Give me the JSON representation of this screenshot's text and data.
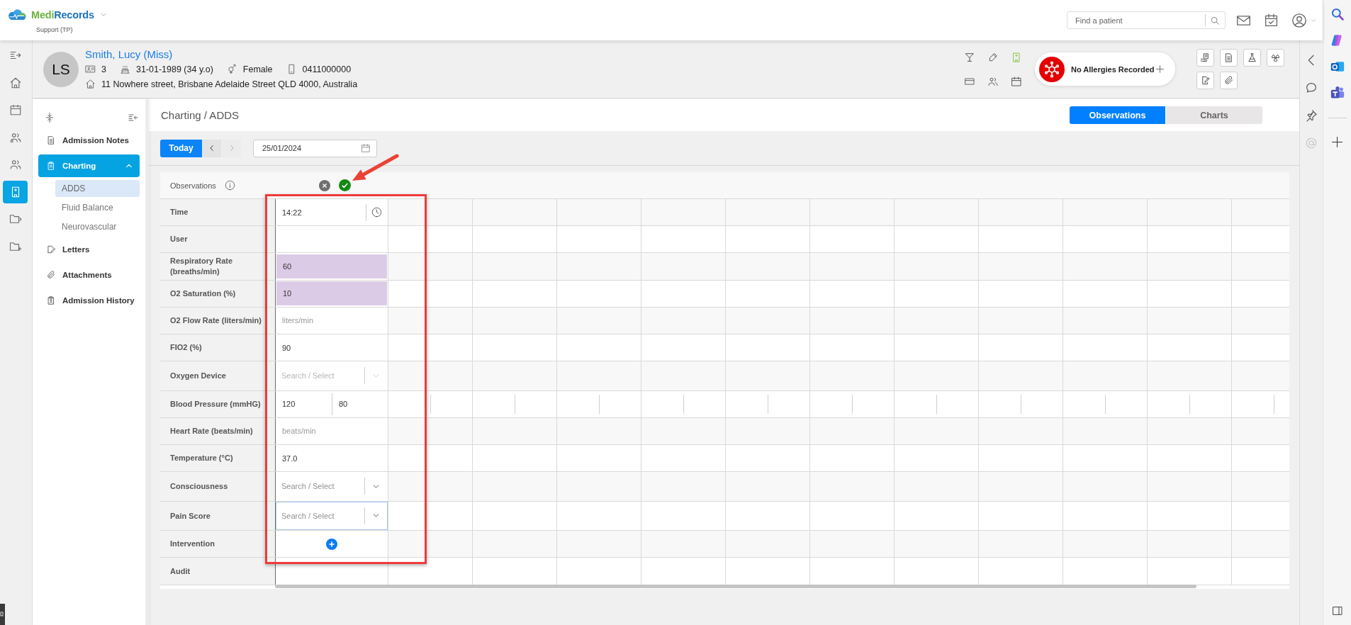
{
  "header": {
    "brand": [
      "Medi",
      "Records"
    ],
    "organisation": "Support (TP)",
    "search": {
      "placeholder": "Find a patient"
    }
  },
  "rail": {
    "items": [
      {
        "selected": false
      },
      {
        "selected": false
      },
      {
        "selected": false
      },
      {
        "selected": false
      },
      {
        "selected": false
      },
      {
        "selected": true
      },
      {
        "selected": false
      },
      {
        "selected": false
      }
    ]
  },
  "patient": {
    "initials": "LS",
    "name": "Smith, Lucy (Miss)",
    "id": "3",
    "dob": "31-01-1989 (34 y.o)",
    "gender": "Female",
    "phone": "0411000000",
    "address": "11 Nowhere street, Brisbane Adelaide Street QLD 4000, Australia"
  },
  "allergies": {
    "label": "No Allergies Recorded"
  },
  "nav": {
    "items": [
      {
        "label": "Admission Notes",
        "selected": false
      },
      {
        "label": "Charting",
        "selected": true,
        "expanded": true,
        "children": [
          {
            "label": "ADDS",
            "selected": true
          },
          {
            "label": "Fluid Balance",
            "selected": false
          },
          {
            "label": "Neurovascular",
            "selected": false
          }
        ]
      },
      {
        "label": "Letters",
        "selected": false
      },
      {
        "label": "Attachments",
        "selected": false
      },
      {
        "label": "Admission History",
        "selected": false
      }
    ]
  },
  "breadcrumb": "Charting / ADDS",
  "view_tabs": [
    {
      "label": "Observations",
      "selected": true
    },
    {
      "label": "Charts",
      "selected": false
    }
  ],
  "toolbar": {
    "today": "Today",
    "prev": {
      "disabled": false
    },
    "next": {
      "disabled": true
    },
    "date": "25/01/2024"
  },
  "observations": {
    "title": "Observations",
    "rows": [
      {
        "label": "Time",
        "kind": "time",
        "value": "14:22"
      },
      {
        "label": "User",
        "kind": "blank"
      },
      {
        "label": "Respiratory Rate (breaths/min)",
        "kind": "input",
        "value": "60",
        "flagged": true
      },
      {
        "label": "O2 Saturation (%)",
        "kind": "input",
        "value": "10",
        "flagged": true
      },
      {
        "label": "O2 Flow Rate (liters/min)",
        "kind": "input",
        "placeholder": "liters/min",
        "flagged": false
      },
      {
        "label": "FIO2 (%)",
        "kind": "input",
        "value": "90",
        "flagged": false
      },
      {
        "label": "Oxygen Device",
        "kind": "select",
        "placeholder": "Search / Select",
        "disabled": true,
        "focused": false
      },
      {
        "label": "Blood Pressure (mmHG)",
        "kind": "pair",
        "values": [
          "120",
          "80"
        ]
      },
      {
        "label": "Heart Rate (beats/min)",
        "kind": "input",
        "placeholder": "beats/min",
        "flagged": false
      },
      {
        "label": "Temperature (°C)",
        "kind": "input",
        "value": "37.0",
        "flagged": false
      },
      {
        "label": "Consciousness",
        "kind": "select",
        "placeholder": "Search / Select",
        "disabled": false,
        "focused": false
      },
      {
        "label": "Pain Score",
        "kind": "select",
        "placeholder": "Search / Select",
        "disabled": false,
        "focused": true
      },
      {
        "label": "Intervention",
        "kind": "add"
      },
      {
        "label": "Audit",
        "kind": "blank"
      }
    ]
  }
}
